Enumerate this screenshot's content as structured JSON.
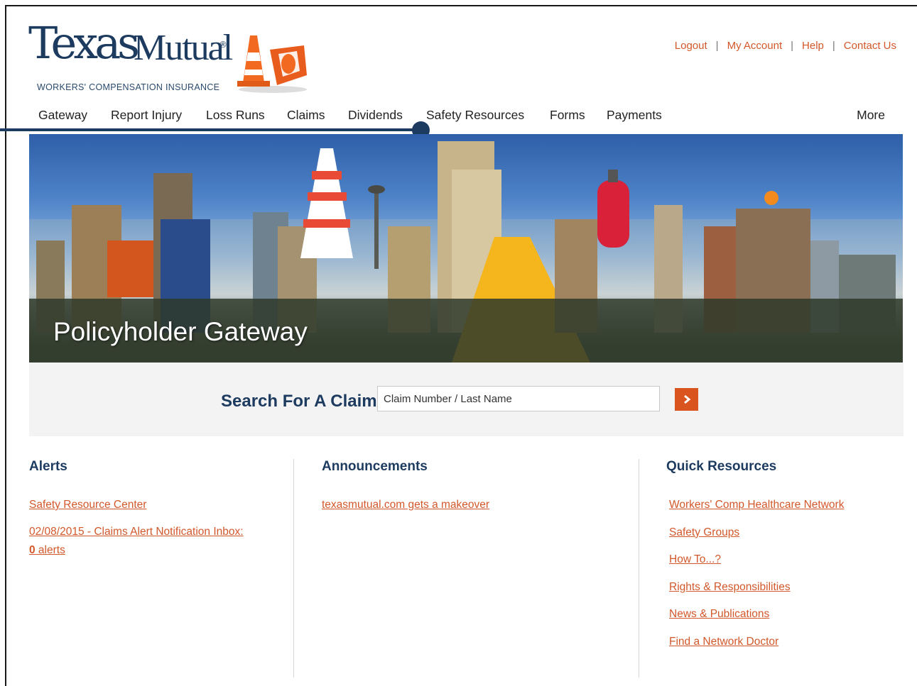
{
  "brand": {
    "name_part1": "Texas",
    "name_part2": "Mutual",
    "reg": "®",
    "tagline": "WORKERS' COMPENSATION INSURANCE"
  },
  "top_links": [
    "Logout",
    "My Account",
    "Help",
    "Contact Us"
  ],
  "nav": {
    "items": [
      "Gateway",
      "Report Injury",
      "Loss Runs",
      "Claims",
      "Dividends",
      "Safety Resources",
      "Forms",
      "Payments"
    ],
    "more": "More"
  },
  "hero": {
    "title": "Policyholder Gateway"
  },
  "search": {
    "label": "Search For A Claim",
    "placeholder": "Claim Number / Last Name"
  },
  "alerts": {
    "heading": "Alerts",
    "link1": "Safety Resource Center",
    "link2": "02/08/2015 - Claims Alert Notification Inbox:",
    "count": "0",
    "count_suffix": " alerts"
  },
  "announcements": {
    "heading": "Announcements",
    "items": [
      "texasmutual.com gets a makeover"
    ]
  },
  "quick_resources": {
    "heading": "Quick Resources",
    "items": [
      "Workers' Comp Healthcare Network",
      "Safety Groups",
      "How To...?",
      "Rights & Responsibilities",
      "News & Publications",
      "Find a Network Doctor"
    ]
  },
  "colors": {
    "brand_navy": "#1d3a5f",
    "link_orange": "#d2582b",
    "button_orange": "#d9541e"
  }
}
